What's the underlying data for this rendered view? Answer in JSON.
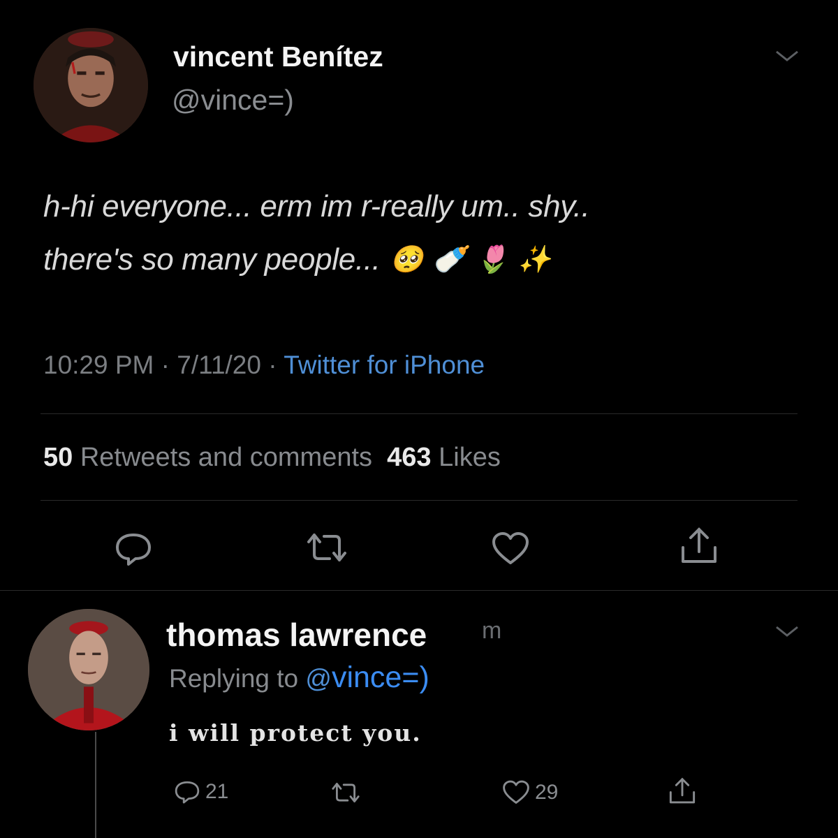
{
  "tweet": {
    "author_name": "vincent Benítez",
    "author_handle": "@vince=)",
    "text_line1": "h-hi everyone... erm im r-really um.. shy..",
    "text_line2": "there's so many people...",
    "emojis": [
      "🥺",
      "🍼",
      "🌷",
      "✨"
    ],
    "time": "10:29 PM",
    "date": "7/11/20",
    "source": "Twitter for iPhone",
    "retweets_count": "50",
    "retweets_label": "Retweets and comments",
    "likes_count": "463",
    "likes_label": "Likes",
    "separator": "·"
  },
  "reply": {
    "author_name": "thomas lawrence",
    "trailing_fragment": "m",
    "replying_prefix": "Replying to",
    "replying_at": "@",
    "replying_handle": "vince=)",
    "text": "i will protect you.",
    "reply_count": "21",
    "like_count": "29"
  },
  "colors": {
    "background": "#000000",
    "link": "#4f8fd6",
    "handle_blue": "#3b8cf2",
    "muted": "#7b7e82"
  },
  "icons": [
    "chevron-down-icon",
    "reply-icon",
    "retweet-icon",
    "like-icon",
    "share-icon"
  ]
}
